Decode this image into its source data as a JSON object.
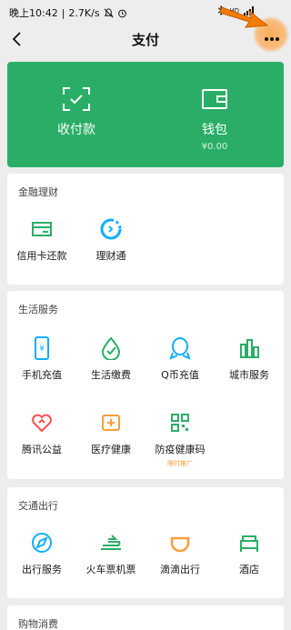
{
  "status_bar": {
    "time": "晚上10:42",
    "speed": "2.7K/s",
    "battery": "5G"
  },
  "nav": {
    "title": "支付"
  },
  "wallet_card": {
    "pay_label": "收付款",
    "wallet_label": "钱包",
    "wallet_balance": "¥0.00"
  },
  "finance": {
    "title": "金融理财",
    "items": [
      {
        "label": "信用卡还款",
        "icon": "credit-card-icon"
      },
      {
        "label": "理财通",
        "icon": "wealth-icon"
      }
    ]
  },
  "life": {
    "title": "生活服务",
    "items": [
      {
        "label": "手机充值",
        "icon": "phone-topup-icon"
      },
      {
        "label": "生活缴费",
        "icon": "utility-bill-icon"
      },
      {
        "label": "Q币充值",
        "icon": "qcoin-icon"
      },
      {
        "label": "城市服务",
        "icon": "city-service-icon"
      },
      {
        "label": "腾讯公益",
        "icon": "charity-icon"
      },
      {
        "label": "医疗健康",
        "icon": "medical-icon"
      },
      {
        "label": "防疫健康码",
        "icon": "qr-code-icon",
        "badge": "限时推广"
      }
    ]
  },
  "transport": {
    "title": "交通出行",
    "items": [
      {
        "label": "出行服务",
        "icon": "travel-icon"
      },
      {
        "label": "火车票机票",
        "icon": "train-icon"
      },
      {
        "label": "滴滴出行",
        "icon": "didi-icon"
      },
      {
        "label": "酒店",
        "icon": "hotel-icon"
      }
    ]
  },
  "shopping": {
    "title": "购物消费"
  },
  "colors": {
    "accent_green": "#2aae67",
    "icon_orange": "#fa9d3b",
    "icon_blue": "#10aeff",
    "icon_red": "#fa5151"
  }
}
